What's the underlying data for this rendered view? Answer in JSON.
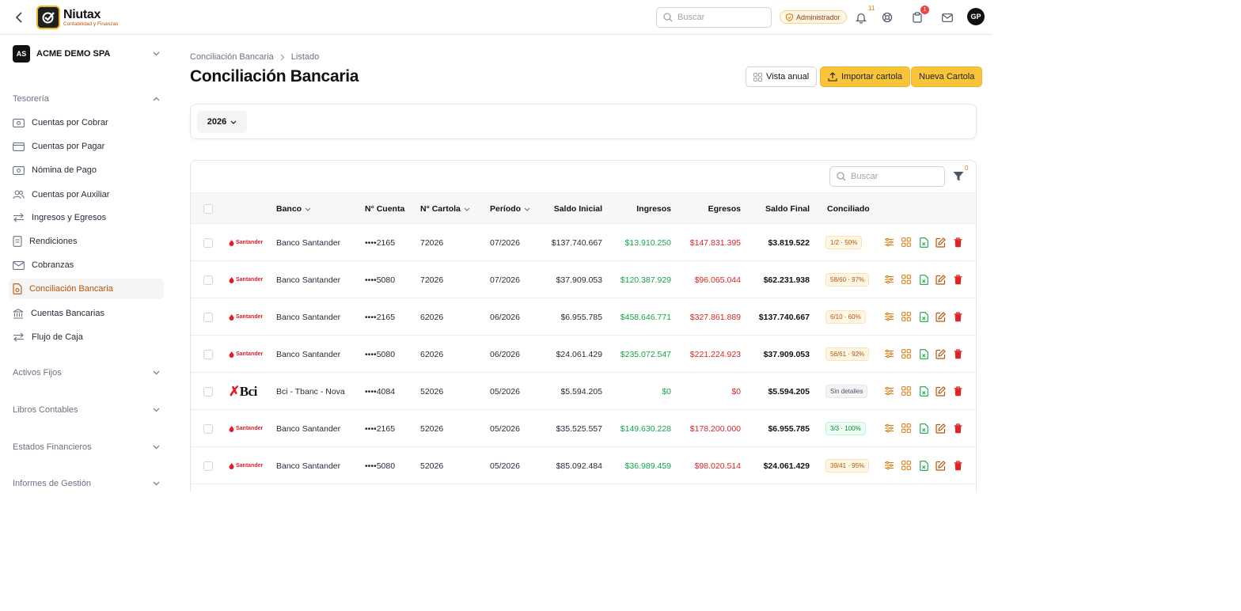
{
  "topbar": {
    "brand_name": "Niutax",
    "brand_tagline": "Contabilidad y Finanzas",
    "search_placeholder": "Buscar",
    "role": "Administrador",
    "notifications_count": "11",
    "tasks_count": "1",
    "avatar_initials": "GP"
  },
  "sidebar": {
    "company_initials": "AS",
    "company_name": "ACME DEMO SPA",
    "section_tesoreria": "Tesorería",
    "items": [
      {
        "label": "Cuentas por Cobrar",
        "icon": "money-icon"
      },
      {
        "label": "Cuentas por Pagar",
        "icon": "card-icon"
      },
      {
        "label": "Nómina de Pago",
        "icon": "money-icon"
      },
      {
        "label": "Cuentas por Auxiliar",
        "icon": "users-icon"
      },
      {
        "label": "Ingresos y Egresos",
        "icon": "transfer-icon"
      },
      {
        "label": "Rendiciones",
        "icon": "receipt-icon"
      },
      {
        "label": "Cobranzas",
        "icon": "mail-icon"
      },
      {
        "label": "Conciliación Bancaria",
        "icon": "document-check-icon",
        "active": true
      },
      {
        "label": "Cuentas Bancarias",
        "icon": "bank-icon"
      },
      {
        "label": "Flujo de Caja",
        "icon": "transfer-icon"
      }
    ],
    "sections": [
      "Activos Fijos",
      "Libros Contables",
      "Estados Financieros",
      "Informes de Gestión"
    ]
  },
  "page": {
    "breadcrumb_root": "Conciliación Bancaria",
    "breadcrumb_current": "Listado",
    "title": "Conciliación Bancaria",
    "btn_annual": "Vista anual",
    "btn_import": "Importar cartola",
    "btn_new": "Nueva Cartola",
    "year": "2026"
  },
  "table": {
    "search_placeholder": "Buscar",
    "filter_count": "0",
    "headers": {
      "banco": "Banco",
      "cuenta": "N° Cuenta",
      "cartola": "N° Cartola",
      "periodo": "Período",
      "saldo_inicial": "Saldo Inicial",
      "ingresos": "Ingresos",
      "egresos": "Egresos",
      "saldo_final": "Saldo Final",
      "conciliado": "Conciliado"
    },
    "rows": [
      {
        "logo": "Santander",
        "banco": "Banco Santander",
        "cuenta": "••••2165",
        "cartola": "72026",
        "periodo": "07/2026",
        "saldo_inicial": "$137.740.667",
        "ingresos": "$13.910.250",
        "egresos": "$147.831.395",
        "saldo_final": "$3.819.522",
        "conciliado": "1/2 · 50%",
        "status": "warn"
      },
      {
        "logo": "Santander",
        "banco": "Banco Santander",
        "cuenta": "••••5080",
        "cartola": "72026",
        "periodo": "07/2026",
        "saldo_inicial": "$37.909.053",
        "ingresos": "$120.387.929",
        "egresos": "$96.065.044",
        "saldo_final": "$62.231.938",
        "conciliado": "58/60 · 97%",
        "status": "warn"
      },
      {
        "logo": "Santander",
        "banco": "Banco Santander",
        "cuenta": "••••2165",
        "cartola": "62026",
        "periodo": "06/2026",
        "saldo_inicial": "$6.955.785",
        "ingresos": "$458.646.771",
        "egresos": "$327.861.889",
        "saldo_final": "$137.740.667",
        "conciliado": "6/10 · 60%",
        "status": "warn"
      },
      {
        "logo": "Santander",
        "banco": "Banco Santander",
        "cuenta": "••••5080",
        "cartola": "62026",
        "periodo": "06/2026",
        "saldo_inicial": "$24.061.429",
        "ingresos": "$235.072.547",
        "egresos": "$221.224.923",
        "saldo_final": "$37.909.053",
        "conciliado": "56/61 · 92%",
        "status": "warn"
      },
      {
        "logo": "Bci",
        "banco": "Bci - Tbanc - Nova",
        "cuenta": "••••4084",
        "cartola": "52026",
        "periodo": "05/2026",
        "saldo_inicial": "$5.594.205",
        "ingresos": "$0",
        "egresos": "$0",
        "saldo_final": "$5.594.205",
        "conciliado": "Sin detalles",
        "status": "none"
      },
      {
        "logo": "Santander",
        "banco": "Banco Santander",
        "cuenta": "••••2165",
        "cartola": "52026",
        "periodo": "05/2026",
        "saldo_inicial": "$35.525.557",
        "ingresos": "$149.630.228",
        "egresos": "$178.200.000",
        "saldo_final": "$6.955.785",
        "conciliado": "3/3 · 100%",
        "status": "ok"
      },
      {
        "logo": "Santander",
        "banco": "Banco Santander",
        "cuenta": "••••5080",
        "cartola": "52026",
        "periodo": "05/2026",
        "saldo_inicial": "$85.092.484",
        "ingresos": "$36.989.459",
        "egresos": "$98.020.514",
        "saldo_final": "$24.061.429",
        "conciliado": "39/41 · 95%",
        "status": "warn"
      }
    ]
  },
  "colors": {
    "accent": "#f8c53a",
    "accent_text": "#b45309",
    "positive": "#16a34a",
    "negative": "#dc2626"
  }
}
